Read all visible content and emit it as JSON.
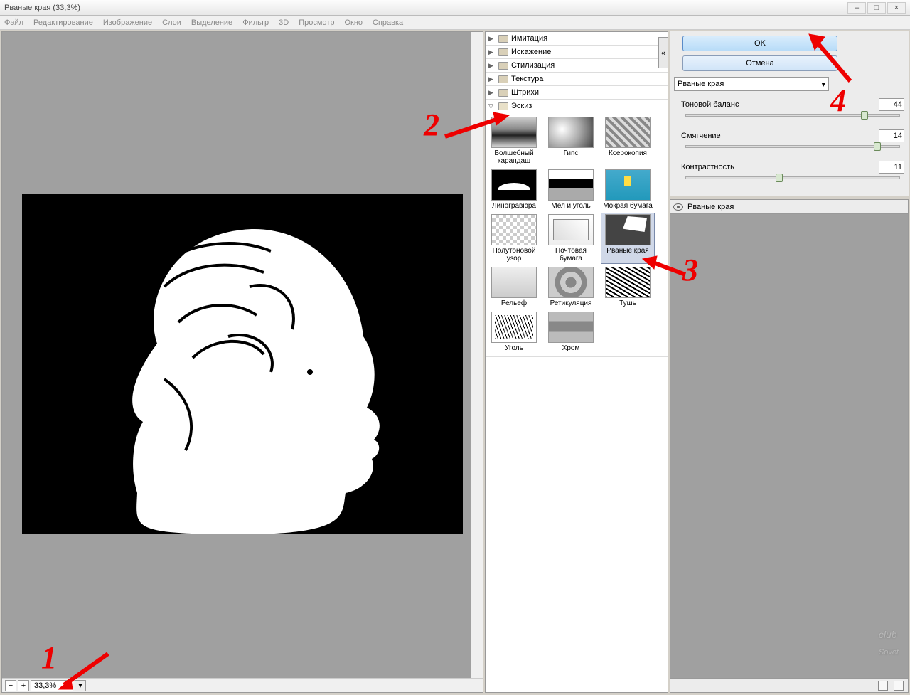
{
  "window": {
    "title": "Рваные края (33,3%)"
  },
  "menu": [
    "Файл",
    "Редактирование",
    "Изображение",
    "Слои",
    "Выделение",
    "Фильтр",
    "3D",
    "Просмотр",
    "Окно",
    "Справка"
  ],
  "zoom": {
    "value": "33,3%"
  },
  "categories": {
    "c1": "Имитация",
    "c2": "Искажение",
    "c3": "Стилизация",
    "c4": "Текстура",
    "c5": "Штрихи",
    "c6": "Эскиз"
  },
  "thumbs": {
    "t1": "Волшебный карандаш",
    "t2": "Гипс",
    "t3": "Ксерокопия",
    "t4": "Линогравюра",
    "t5": "Мел и уголь",
    "t6": "Мокрая бумага",
    "t7": "Полутоновой узор",
    "t8": "Почтовая бумага",
    "t9": "Рваные края",
    "t10": "Рельеф",
    "t11": "Ретикуляция",
    "t12": "Тушь",
    "t13": "Уголь",
    "t14": "Хром"
  },
  "buttons": {
    "ok": "OK",
    "cancel": "Отмена"
  },
  "filter_select": "Рваные края",
  "sliders": {
    "s1": {
      "label": "Тоновой баланс",
      "value": "44"
    },
    "s2": {
      "label": "Смягчение",
      "value": "14"
    },
    "s3": {
      "label": "Контрастность",
      "value": "11"
    }
  },
  "layer": {
    "name": "Рваные края"
  },
  "anno": {
    "n1": "1",
    "n2": "2",
    "n3": "3",
    "n4": "4"
  },
  "watermark": {
    "a": "club",
    "b": "Sovet"
  }
}
